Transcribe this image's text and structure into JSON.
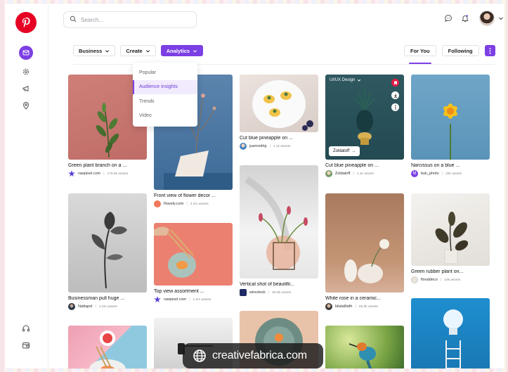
{
  "search": {
    "placeholder": "Search..."
  },
  "icons": {
    "logo": "pinterest-logo",
    "sidebar": [
      "mail-icon",
      "settings-icon",
      "megaphone-icon",
      "location-icon",
      "headset-icon",
      "wallet-icon"
    ],
    "top": [
      "chat-icon",
      "bell-icon",
      "avatar",
      "chevron-down-icon"
    ]
  },
  "colors": {
    "accent": "#7b3fe4",
    "brand": "#e60023"
  },
  "filters": [
    {
      "label": "Business"
    },
    {
      "label": "Create"
    },
    {
      "label": "Analytics"
    }
  ],
  "tabs": {
    "for_you": "For You",
    "following": "Following"
  },
  "analytics_menu": [
    "Popular",
    "Audience insights",
    "Trends",
    "Video"
  ],
  "pins": [
    {
      "title": "Green plant branch on a ...",
      "source": "rawpixel.com",
      "count": "179.6k assets"
    },
    {
      "title": "Businessman pull huge ...",
      "source": "Nattapol",
      "count": "2.2m assets"
    },
    {
      "title": "Front view of flower decor ...",
      "source": "Ravely.com",
      "count": "2.2m assets"
    },
    {
      "title": "Top view assortment ...",
      "source": "rawpixel.com",
      "count": "2.2m assets"
    },
    {
      "title": "Cut blue pineapple on ...",
      "source": "juanrodrig",
      "count": "1.1k assets"
    },
    {
      "title": "Vertical shot of beautifil...",
      "source": "wirestock",
      "count": "50.8k assets"
    },
    {
      "title": "Cut blue pineapple on ...",
      "source": "Zoldatoff",
      "count": "1.1k assets",
      "tag": "UI/UX Design",
      "button": "Zoldatoff"
    },
    {
      "title": "White rose in a ceramic...",
      "source": "bilalalfaith",
      "count": "65.8k assets"
    },
    {
      "title": "Narcissus on a blue ...",
      "source": "buk_photo",
      "count": "34k assets"
    },
    {
      "title": "Green rubber plant on...",
      "source": "floraldeco",
      "count": "18k assets"
    }
  ],
  "watermark": "creativefabrica.com"
}
